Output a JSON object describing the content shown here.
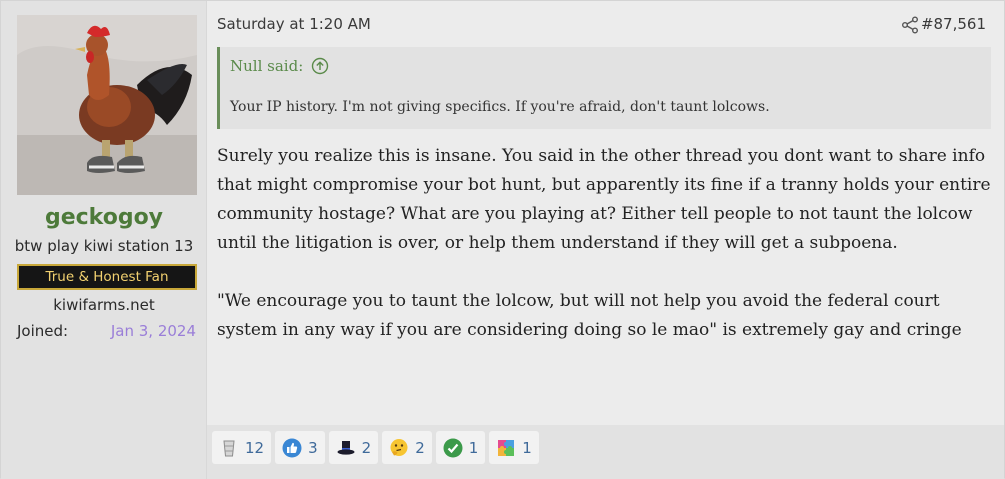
{
  "user": {
    "username": "geckogoy",
    "title": "btw play kiwi station 13",
    "banner": "True & Honest Fan",
    "site": "kiwifarms.net",
    "joined_label": "Joined:",
    "joined_date": "Jan 3, 2024"
  },
  "post": {
    "timestamp": "Saturday at 1:20 AM",
    "number": "#87,561",
    "quote": {
      "author": "Null said:",
      "text": "Your IP history. I'm not giving specifics. If you're afraid, don't taunt lolcows."
    },
    "paragraphs": [
      "Surely you realize this is insane. You said in the other thread you dont want to share info that might compromise your bot hunt, but apparently its fine if a tranny holds your entire community hostage? What are you playing at? Either tell people to not taunt the lolcow until the litigation is over, or help them understand if they will get a subpoena.",
      "\"We encourage you to taunt the lolcow, but will not help you avoid the federal court system in any way if you are considering doing so le mao\" is extremely gay and cringe"
    ]
  },
  "reactions": [
    {
      "icon": "drinking-glass-icon",
      "count": "12"
    },
    {
      "icon": "thumbs-up-icon",
      "count": "3"
    },
    {
      "icon": "top-hat-icon",
      "count": "2"
    },
    {
      "icon": "thinking-face-icon",
      "count": "2"
    },
    {
      "icon": "checkmark-icon",
      "count": "1"
    },
    {
      "icon": "puzzle-piece-icon",
      "count": "1"
    }
  ]
}
